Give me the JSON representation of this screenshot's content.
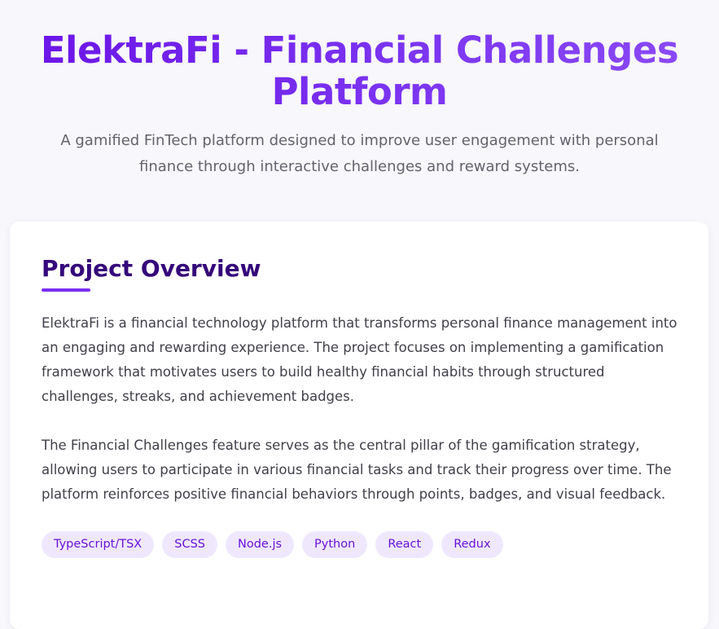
{
  "hero": {
    "title": "ElektraFi - Financial Challenges Platform",
    "subtitle": "A gamified FinTech platform designed to improve user engagement with personal finance through interactive challenges and reward systems."
  },
  "overview": {
    "heading": "Project Overview",
    "paragraphs": [
      "ElektraFi is a financial technology platform that transforms personal finance management into an engaging and rewarding experience. The project focuses on implementing a gamification framework that motivates users to build healthy financial habits through structured challenges, streaks, and achievement badges.",
      "The Financial Challenges feature serves as the central pillar of the gamification strategy, allowing users to participate in various financial tasks and track their progress over time. The platform reinforces positive financial behaviors through points, badges, and visual feedback."
    ],
    "tags": [
      "TypeScript/TSX",
      "SCSS",
      "Node.js",
      "Python",
      "React",
      "Redux"
    ]
  },
  "colors": {
    "title_gradient_start": "#6a12e6",
    "title_gradient_end": "#8c4bf4",
    "heading": "#35077a",
    "accent": "#7b2ff0",
    "tag_background": "#efe8fd",
    "tag_text": "#6a12d6",
    "page_background": "#f8f7fb"
  }
}
